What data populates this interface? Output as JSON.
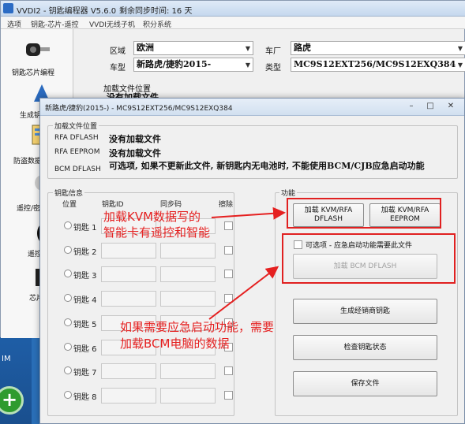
{
  "window": {
    "title": "VVDI2 - 钥匙编程器 V5.6.0",
    "sync_text": "剩余同步时间: 16 天"
  },
  "menu": [
    "选项",
    "钥匙-芯片-遥控",
    "VVDI无线子机",
    "积分系统"
  ],
  "sidebar": [
    {
      "label": "钥匙芯片编程",
      "icon": "car-key-icon"
    },
    {
      "label": "生成钥",
      "icon": "key-gen-icon"
    },
    {
      "label": "防盗数据",
      "icon": "immo-data-icon"
    },
    {
      "label": "遥控/密",
      "icon": "remote-icon"
    },
    {
      "label": "遥控",
      "icon": "remote-key-icon"
    },
    {
      "label": "芯片",
      "icon": "chip-icon"
    }
  ],
  "selector": {
    "region_label": "区域",
    "region_value": "欧洲",
    "make_label": "车厂",
    "make_value": "路虎",
    "model_label": "车型",
    "model_value": "新路虎/捷豹2015-",
    "type_label": "类型",
    "type_value": "MC9S12EXT256/MC9S12EXQ384",
    "load_label": "加载文件位置",
    "load_value": "没有加载文件"
  },
  "dialog": {
    "title": "新路虎/捷豹(2015-) - MC9S12EXT256/MC9S12EXQ384",
    "file_group_title": "加载文件位置",
    "files": [
      {
        "label": "RFA DFLASH",
        "value": "没有加载文件"
      },
      {
        "label": "RFA EEPROM",
        "value": "没有加载文件"
      },
      {
        "label": "BCM DFLASH",
        "value": "可选项, 如果不更新此文件, 新钥匙内无电池时, 不能使用BCM/CJB应急启动功能"
      }
    ],
    "key_group_title": "钥匙信息",
    "col_position": "位置",
    "col_key_id": "钥匙ID",
    "col_sync": "同步码",
    "col_erase": "擦除",
    "keys": [
      "钥匙 1",
      "钥匙 2",
      "钥匙 3",
      "钥匙 4",
      "钥匙 5",
      "钥匙 6",
      "钥匙 7",
      "钥匙 8"
    ],
    "func_group_title": "功能",
    "btn_load_kvm_dflash": "加载 KVM/RFA DFLASH",
    "btn_load_kvm_eeprom": "加载 KVM/RFA EEPROM",
    "optional_checkbox": "可选项 - 应急启动功能需要此文件",
    "btn_load_bcm": "加载 BCM DFLASH",
    "btn_gen_dealer_key": "生成经销商钥匙",
    "btn_check_key": "检查钥匙状态",
    "btn_save_file": "保存文件"
  },
  "annotations": {
    "note1_line1": "加载KVM数据写的",
    "note1_line2": "智能卡有遥控和智能",
    "note2_line1": "如果需要应急启动功能，需要",
    "note2_line2": "加载BCM电脑的数据"
  },
  "desktop": {
    "label": "IM"
  },
  "colors": {
    "annotation": "#e52020",
    "titlebar": "#c5d8ee"
  }
}
